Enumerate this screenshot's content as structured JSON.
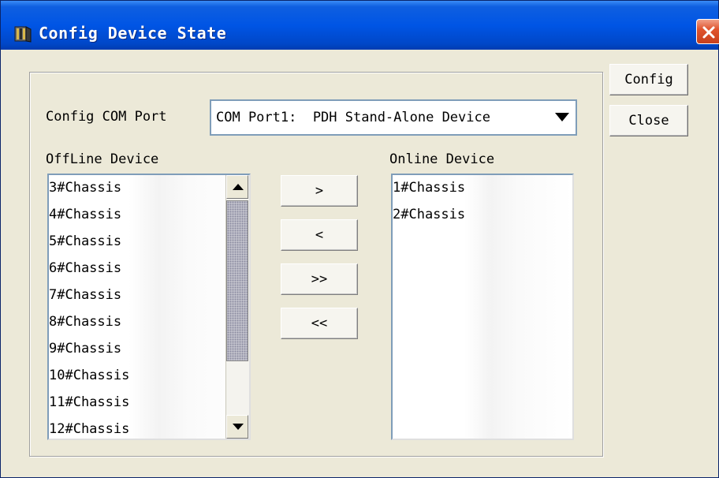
{
  "window": {
    "title": "Config Device State",
    "icon": "chassis-icon",
    "close_icon": "close-icon"
  },
  "form": {
    "com_port_label": "Config COM Port",
    "com_port_value": "COM Port1:  PDH Stand-Alone Device",
    "offline_label": "OffLine Device",
    "online_label": "Online Device"
  },
  "offline_devices": [
    "3#Chassis",
    "4#Chassis",
    "5#Chassis",
    "6#Chassis",
    "7#Chassis",
    "8#Chassis",
    "9#Chassis",
    "10#Chassis",
    "11#Chassis",
    "12#Chassis"
  ],
  "online_devices": [
    "1#Chassis",
    "2#Chassis"
  ],
  "move_buttons": {
    "add": ">",
    "remove": "<",
    "add_all": ">>",
    "remove_all": "<<"
  },
  "actions": {
    "config": "Config",
    "close": "Close"
  },
  "colors": {
    "titlebar": "#0055e5",
    "close_button": "#e0552f",
    "dialog_bg": "#ece9d8"
  }
}
